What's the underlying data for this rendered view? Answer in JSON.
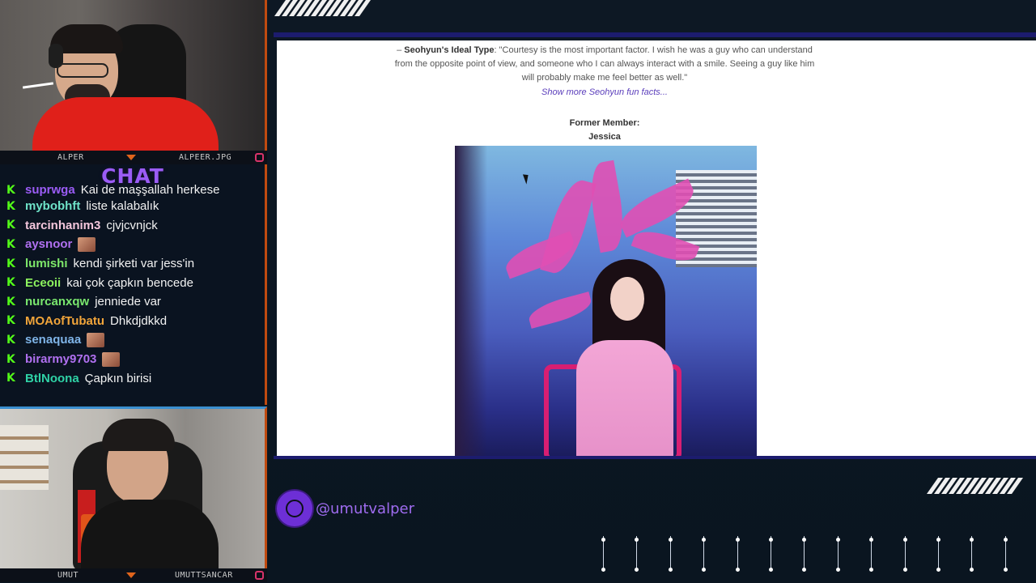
{
  "webcams": {
    "top": {
      "name": "ALPER",
      "handle": "ALPEER.JPG"
    },
    "bottom": {
      "name": "UMUT",
      "handle": "UMUTTSANCAR"
    }
  },
  "chat": {
    "title": "CHAT",
    "messages": [
      {
        "user": "suprwga",
        "text": "Kai de maşşallah herkese",
        "color": "#9b5cf6",
        "emote": false
      },
      {
        "user": "mybobhft",
        "text": "liste kalabalık",
        "color": "#6fe3c9",
        "emote": false
      },
      {
        "user": "tarcinhanim3",
        "text": "cjvjcvnjck",
        "color": "#f3c6dc",
        "emote": false
      },
      {
        "user": "aysnoor",
        "text": "",
        "color": "#b070f0",
        "emote": true
      },
      {
        "user": "lumishi",
        "text": "kendi şirketi var jess'in",
        "color": "#7ee86a",
        "emote": false
      },
      {
        "user": "Eceoii",
        "text": "kai çok çapkın bencede",
        "color": "#8cf25e",
        "emote": false
      },
      {
        "user": "nurcanxqw",
        "text": "jenniede var",
        "color": "#7ae86e",
        "emote": false
      },
      {
        "user": "MOAofTubatu",
        "text": "Dhkdjdkkd",
        "color": "#f2a53a",
        "emote": false
      },
      {
        "user": "senaquaa",
        "text": "",
        "color": "#7fb4e8",
        "emote": true
      },
      {
        "user": "birarmy9703",
        "text": "",
        "color": "#b070f0",
        "emote": true
      },
      {
        "user": "BtlNoona",
        "text": "Çapkın birisi",
        "color": "#2fd2a6",
        "emote": false
      }
    ]
  },
  "article": {
    "ideal_label": "Seohyun's Ideal Type",
    "ideal_prefix": "– ",
    "ideal_text": ": \"Courtesy is the most important factor. I wish he was a guy who can understand from the opposite point of view, and someone who I can always interact with a smile. Seeing a guy like him will probably make me feel better as well.\"",
    "show_more": "Show more Seohyun fun facts...",
    "former_label": "Former Member:",
    "former_name": "Jessica"
  },
  "social": {
    "handle": "@umutvalper",
    "icon": "globe-icon"
  }
}
